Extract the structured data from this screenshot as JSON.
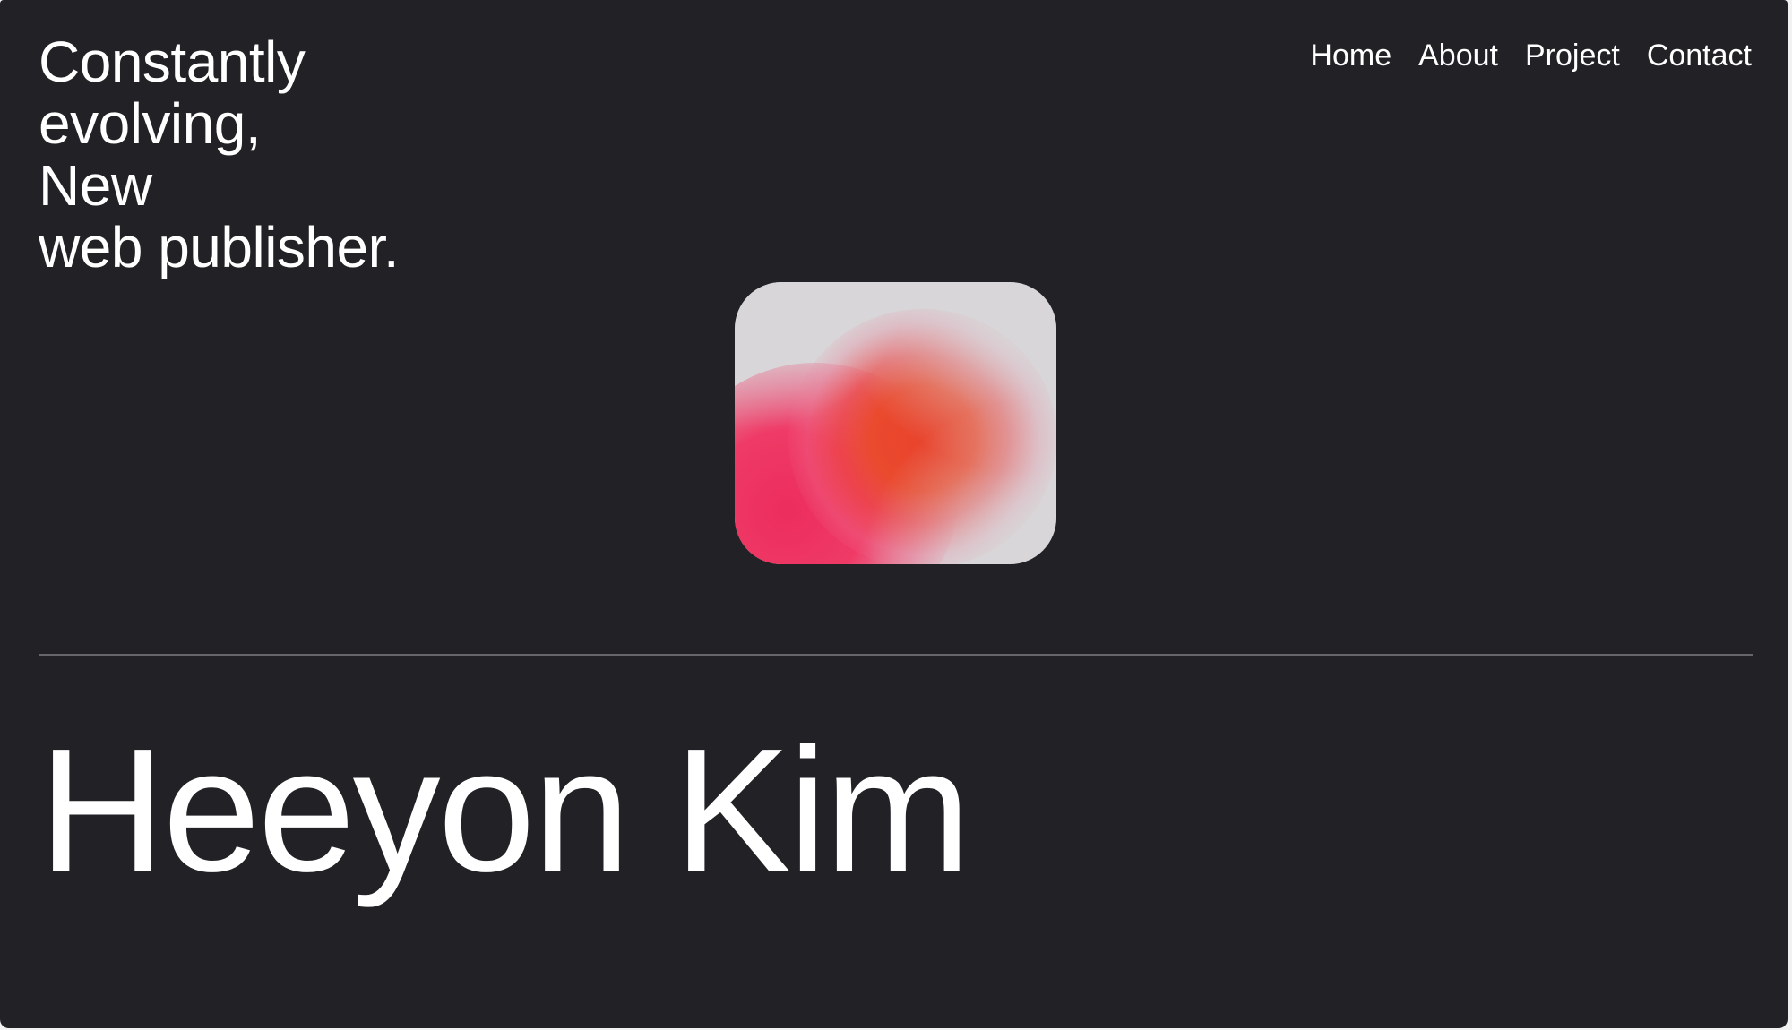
{
  "header": {
    "tagline_lines": [
      "Constantly",
      "evolving,",
      "New",
      "web publisher."
    ]
  },
  "nav": {
    "items": [
      "Home",
      "About",
      "Project",
      "Contact"
    ]
  },
  "hero": {
    "name": "Heeyon Kim"
  },
  "colors": {
    "background": "#222226",
    "text": "#ffffff",
    "divider": "#66666b",
    "gradient_orange": "#e9432c",
    "gradient_pink": "#ec2d5e",
    "gradient_base": "#d8d6d8"
  }
}
